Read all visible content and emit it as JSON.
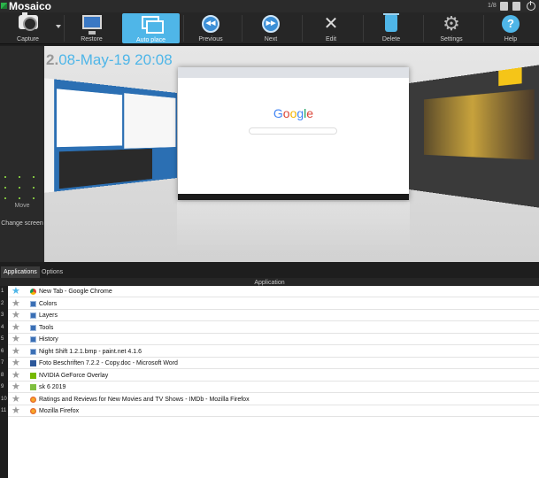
{
  "app": {
    "title": "Mosaico",
    "counter": "1/8"
  },
  "toolbar": {
    "buttons": [
      {
        "id": "capture",
        "label": "Capture",
        "icon": "camera-icon"
      },
      {
        "id": "restore",
        "label": "Restore",
        "icon": "monitor-icon"
      },
      {
        "id": "autoplace",
        "label": "Auto place",
        "icon": "windows-icon",
        "active": true
      },
      {
        "id": "previous",
        "label": "Previous",
        "icon": "rewind-icon",
        "glyph": "◀◀"
      },
      {
        "id": "next",
        "label": "Next",
        "icon": "forward-icon",
        "glyph": "▶▶"
      },
      {
        "id": "edit",
        "label": "Edit",
        "icon": "wrench-icon",
        "glyph": "✕"
      },
      {
        "id": "delete",
        "label": "Delete",
        "icon": "trash-icon"
      },
      {
        "id": "settings",
        "label": "Settings",
        "icon": "gear-icon",
        "glyph": "⚙"
      },
      {
        "id": "help",
        "label": "Help",
        "icon": "help-icon",
        "glyph": "?"
      }
    ]
  },
  "preview": {
    "index": "2.",
    "datetime": "08-May-19 20:08",
    "google_text": "Google",
    "left_panel": {
      "move": "Move",
      "change_screen": "Change screen"
    }
  },
  "tabs": [
    {
      "label": "Applications",
      "active": true
    },
    {
      "label": "Options"
    }
  ],
  "table": {
    "header": "Application",
    "rows": [
      {
        "n": "1",
        "fav": true,
        "icon": "chrome",
        "name": "New Tab - Google Chrome"
      },
      {
        "n": "2",
        "fav": false,
        "icon": "app",
        "name": "Colors"
      },
      {
        "n": "3",
        "fav": false,
        "icon": "app",
        "name": "Layers"
      },
      {
        "n": "4",
        "fav": false,
        "icon": "app",
        "name": "Tools"
      },
      {
        "n": "5",
        "fav": false,
        "icon": "app",
        "name": "History"
      },
      {
        "n": "6",
        "fav": false,
        "icon": "app",
        "name": "Night Shift 1.2.1.bmp - paint.net 4.1.6"
      },
      {
        "n": "7",
        "fav": false,
        "icon": "word",
        "name": "Foto Beschriften 7.2.2 - Copy.doc - Microsoft Word"
      },
      {
        "n": "8",
        "fav": false,
        "icon": "nvidia",
        "name": "NVIDIA GeForce Overlay"
      },
      {
        "n": "9",
        "fav": false,
        "icon": "sk",
        "name": "sk 6 2019"
      },
      {
        "n": "10",
        "fav": false,
        "icon": "firefox",
        "name": "Ratings and Reviews for New Movies and TV Shows - IMDb - Mozilla Firefox"
      },
      {
        "n": "11",
        "fav": false,
        "icon": "firefox",
        "name": "Mozilla Firefox"
      }
    ]
  },
  "colors": {
    "accent": "#4fb6e8",
    "background": "#1e1e1e"
  }
}
